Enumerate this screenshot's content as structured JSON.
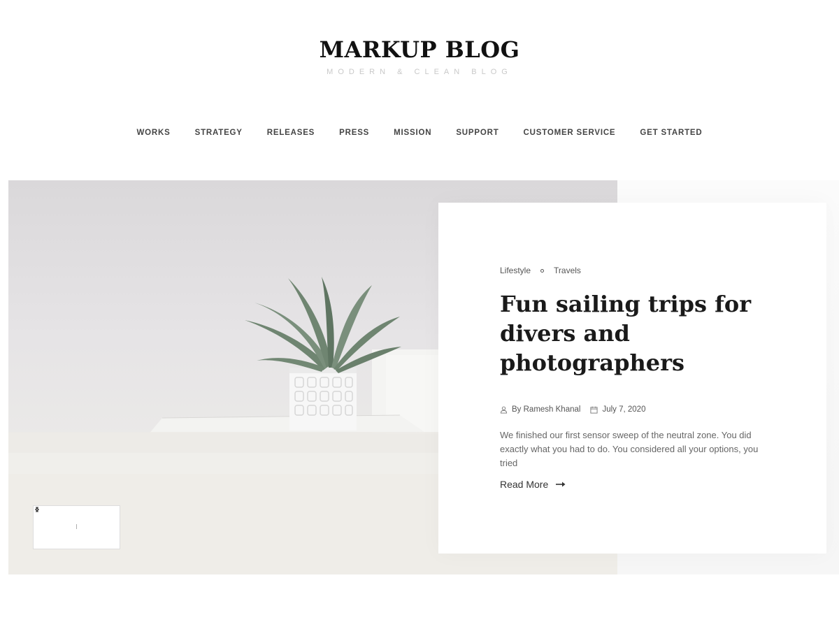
{
  "site": {
    "title": "MARKUP BLOG",
    "tagline": "MODERN & CLEAN BLOG"
  },
  "nav": {
    "items": [
      {
        "label": "WORKS"
      },
      {
        "label": "STRATEGY"
      },
      {
        "label": "RELEASES"
      },
      {
        "label": "PRESS"
      },
      {
        "label": "MISSION"
      },
      {
        "label": "SUPPORT"
      },
      {
        "label": "CUSTOMER SERVICE"
      },
      {
        "label": "GET STARTED"
      }
    ]
  },
  "slider": {
    "counter": "I",
    "prev_icon": "chevron-left-icon",
    "next_icon": "chevron-right-icon"
  },
  "post": {
    "categories": [
      "Lifestyle",
      "Travels"
    ],
    "title": "Fun sailing trips for divers and photographers",
    "author": "By Ramesh Khanal",
    "date": "July 7, 2020",
    "excerpt": "We finished our first sensor sweep of the neutral zone. You did exactly what you had to do. You considered all your options, you tried",
    "read_more": "Read More",
    "author_icon": "user-icon",
    "date_icon": "calendar-icon",
    "read_more_icon": "arrow-right-icon"
  }
}
